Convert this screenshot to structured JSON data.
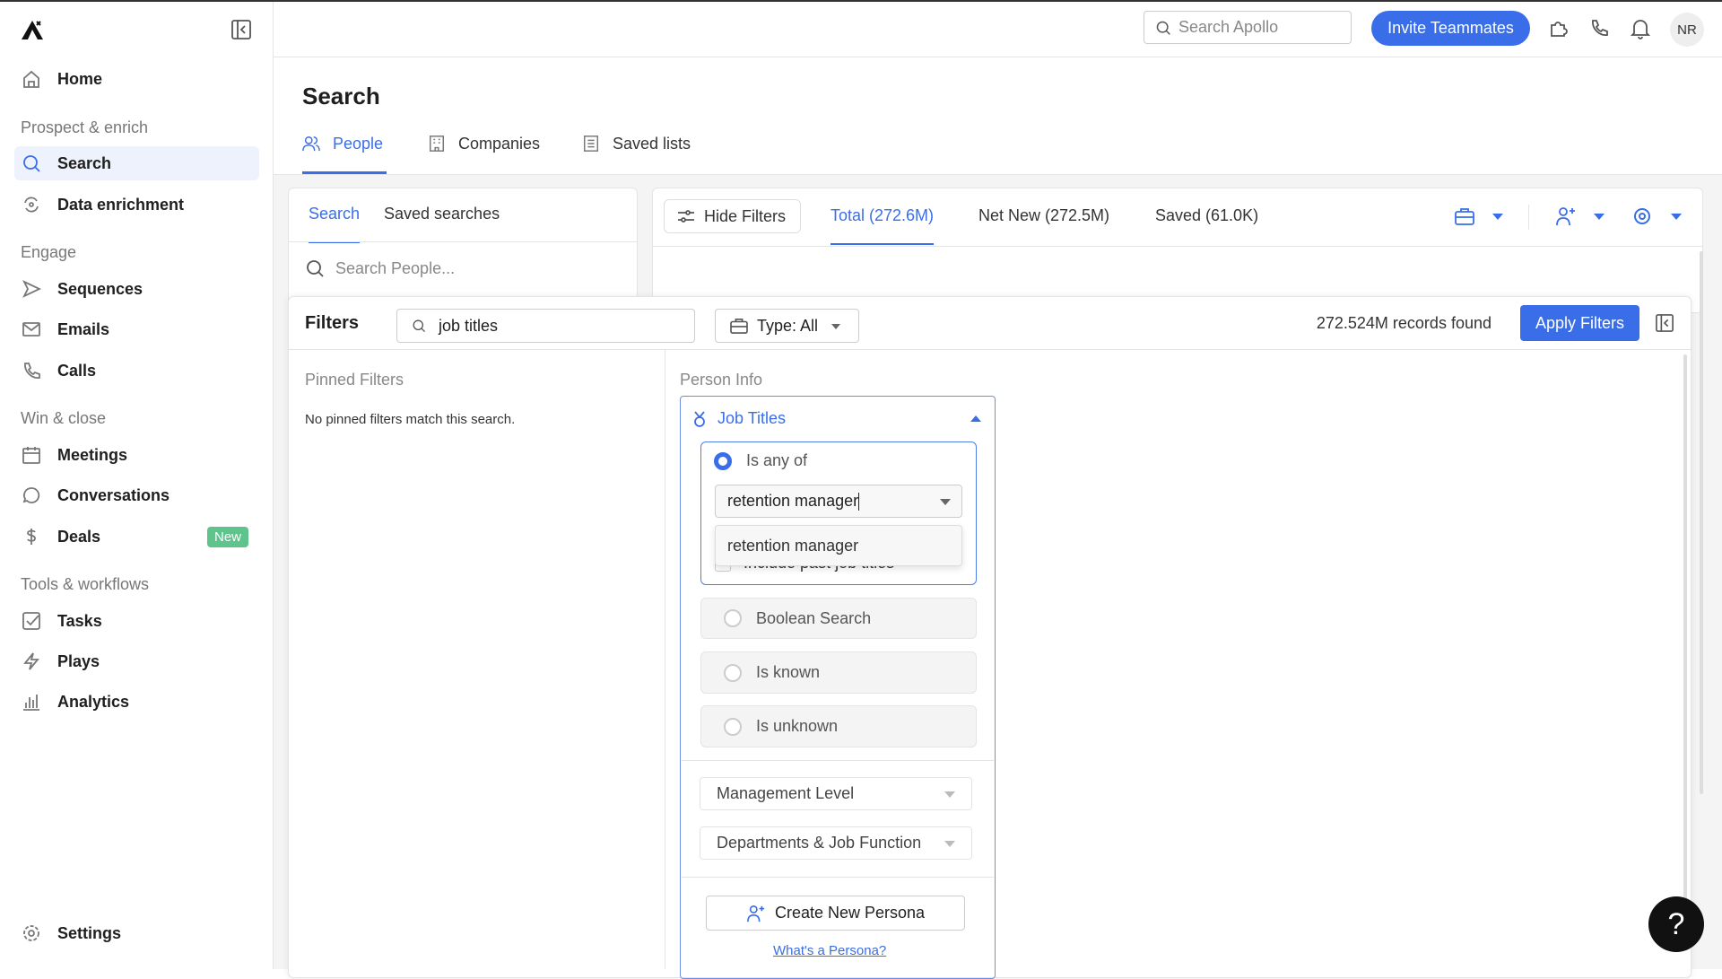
{
  "sidebar": {
    "home": "Home",
    "sections": [
      "Prospect & enrich",
      "Engage",
      "Win & close",
      "Tools & workflows"
    ],
    "items": {
      "search": "Search",
      "enrichment": "Data enrichment",
      "sequences": "Sequences",
      "emails": "Emails",
      "calls": "Calls",
      "meetings": "Meetings",
      "conversations": "Conversations",
      "deals": "Deals",
      "tasks": "Tasks",
      "plays": "Plays",
      "analytics": "Analytics",
      "settings": "Settings"
    },
    "deals_badge": "New"
  },
  "topbar": {
    "search_placeholder": "Search Apollo",
    "invite": "Invite Teammates",
    "avatar": "NR"
  },
  "page": {
    "title": "Search",
    "tabs": [
      "People",
      "Companies",
      "Saved lists"
    ]
  },
  "left_card": {
    "tabs": [
      "Search",
      "Saved searches"
    ],
    "search_placeholder": "Search People..."
  },
  "results": {
    "hide_filters": "Hide Filters",
    "tabs": [
      "Total (272.6M)",
      "Net New (272.5M)",
      "Saved (61.0K)"
    ]
  },
  "filters": {
    "title": "Filters",
    "search_value": "job titles",
    "type": "Type: All",
    "records": "272.524M records found",
    "apply": "Apply Filters",
    "pinned_title": "Pinned Filters",
    "pinned_empty": "No pinned filters match this search.",
    "person_info": "Person Info",
    "job_titles": "Job Titles",
    "is_any_of": "Is any of",
    "input_value": "retention manager",
    "suggestion": "retention manager",
    "include_past": "Include past job titles",
    "options": [
      "Boolean Search",
      "Is known",
      "Is unknown"
    ],
    "selects": [
      "Management Level",
      "Departments & Job Function"
    ],
    "create_persona": "Create New Persona",
    "whats_persona": "What's a Persona?"
  },
  "colors": {
    "accent": "#3a6ee8",
    "badge": "#5ec48b"
  },
  "help": "?"
}
